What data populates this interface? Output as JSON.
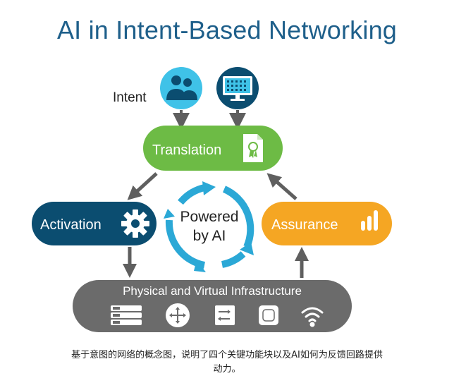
{
  "title": "AI in Intent-Based Networking",
  "nodes": {
    "intent_label": "Intent",
    "translation_label": "Translation",
    "activation_label": "Activation",
    "assurance_label": "Assurance",
    "center_line1": "Powered",
    "center_line2": "by AI",
    "infrastructure_label": "Physical and Virtual Infrastructure"
  },
  "icons": {
    "intent_people": "users-icon",
    "intent_dashboard": "monitor-dashboard-icon",
    "translation": "certificate-icon",
    "activation": "gear-icon",
    "assurance": "signal-bars-icon",
    "infra": [
      "server-icon",
      "router-icon",
      "switch-icon",
      "access-point-icon",
      "wifi-icon"
    ]
  },
  "colors": {
    "title": "#1e5f8a",
    "translation": "#6dbb45",
    "activation": "#0b4d70",
    "assurance": "#f5a623",
    "infrastructure": "#6b6b6b",
    "cycle": "#2ba8d6",
    "intent_circle": "#3fc2e8",
    "intent_circle_dark": "#0b4d70"
  },
  "caption": {
    "line1": "基于意图的网络的概念图，说明了四个关键功能块以及AI如何为反馈回路提供",
    "line2": "动力。"
  }
}
